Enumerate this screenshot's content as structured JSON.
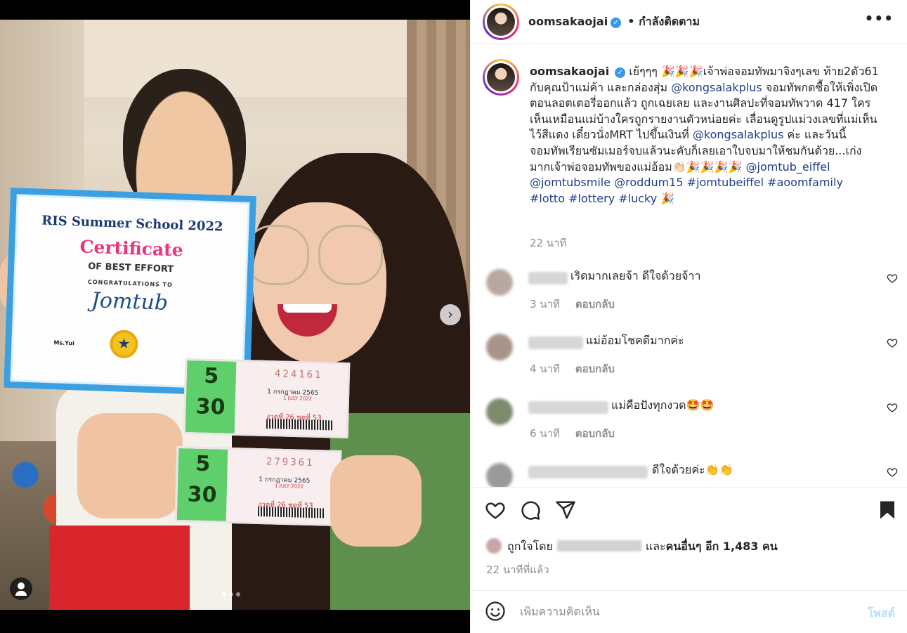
{
  "post": {
    "username": "oomsakaojai",
    "following_label": "• กำลังติดตาม",
    "more_label": "•••",
    "caption": {
      "text1": "เย้ๆๆๆ",
      "confetti1": "🎉🎉🎉",
      "text2": "เจ้าพ่อจอมทัพมาจิงๆเลข ท้าย2ตัว61 กับคุณป้าแม่ค้า และกล่องสุ่ม",
      "mention1": "@kongsalakplus",
      "text3": "จอมทัพกดซื้อให้เพิ่งเปิดตอนลอตเตอรี่ออกแล้ว ถูกเฉยเลย และงานศิลปะที่จอมทัพวาด 417 ใครเห็นเหมือนแม่บ้างใครถูกรายงานตัวหน่อยค่ะ เลื่อนดูรูปแม่วงเลขที่แม่เห็นไว้สีแดง เดี๋ยวนั่งMRT ไปขึ้นเงินที่",
      "mention2": "@kongsalakplus",
      "text4": "ค่ะ และวันนี้จอมทัพเรียนซัมเมอร์จบแล้วนะคับก็เลยเอาใบจบมาให้ชมกันด้วย...เก่งมากเจ้าพ่อจอมทัพของแม่อ้อม",
      "emoji2": "👏🏻🎉🎉🎉🎉",
      "mention3": "@jomtub_eiffel",
      "mention4": "@jomtubsmile",
      "mention5": "@roddum15",
      "hashtag1": "#jomtubeiffel",
      "hashtag2": "#aoomfamily",
      "hashtag3": "#lotto",
      "hashtag4": "#lottery",
      "hashtag5": "#lucky",
      "emoji3": "🎉",
      "time": "22 นาที"
    },
    "comments": [
      {
        "text": "เริดมากเลยจ้า ดีใจด้วยจ้าา",
        "time": "3 นาที",
        "reply": "ตอบกลับ"
      },
      {
        "text": "แม่อ้อมโชคดีมากค่ะ",
        "time": "4 นาที",
        "reply": "ตอบกลับ"
      },
      {
        "text": "แม่คือปังทุกงวด🤩🤩",
        "time": "6 นาที",
        "reply": "ตอบกลับ"
      },
      {
        "text": "ดีใจด้วยค่ะ👏👏",
        "time": "",
        "reply": ""
      }
    ],
    "likes": {
      "prefix": "ถูกใจโดย",
      "mid": "และ",
      "others": "คนอื่นๆ อีก 1,483 คน"
    },
    "posted_ago": "22 นาทีที่แล้ว",
    "add_comment": {
      "placeholder": "เพิ่มความคิดเห็น",
      "post_label": "โพสต์"
    }
  },
  "photo": {
    "certificate": {
      "title": "RIS Summer School 2022",
      "big": "Certificate",
      "sub": "OF BEST EFFORT",
      "congrats": "CONGRATULATIONS TO",
      "name": "Jomtub",
      "sign": "Ms.Yui",
      "badge": "★"
    },
    "tickets": [
      {
        "prize1": "5",
        "prize2": "30",
        "number": "424161",
        "date": "1 กรกฎาคม 2565",
        "date_en": "1 JULY 2022",
        "mini": "งวดที่ 26   ชุดที่ 53"
      },
      {
        "prize1": "5",
        "prize2": "30",
        "number": "279361",
        "date": "1 กรกฎาคม 2565",
        "date_en": "1 JULY 2022",
        "mini": "งวดที่ 26   ชุดที่ 53"
      }
    ],
    "next_arrow": "›"
  },
  "colors": {
    "accent": "#3897f0",
    "link": "#1f3c88",
    "muted": "#8e8e8e",
    "post_disabled": "#b2dffc"
  }
}
